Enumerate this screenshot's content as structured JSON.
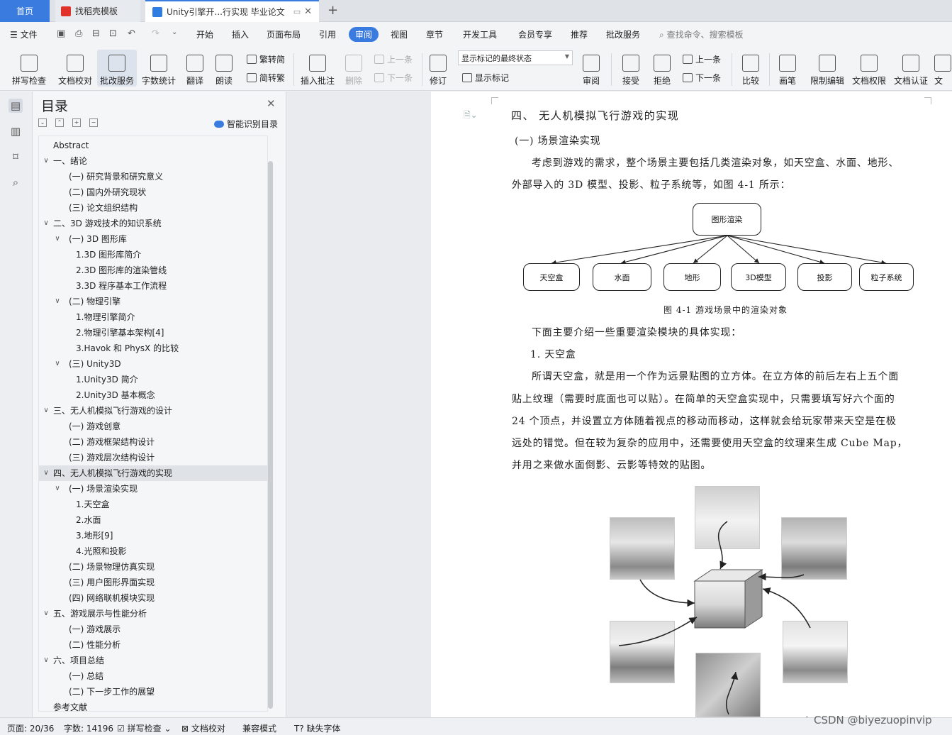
{
  "tabs": {
    "home": "首页",
    "template": "找稻壳模板",
    "document": "Unity引擎开...行实现 毕业论文",
    "plus": "+",
    "close": "✕"
  },
  "menu": {
    "file": "文件",
    "items": [
      "开始",
      "插入",
      "页面布局",
      "引用",
      "审阅",
      "视图",
      "章节",
      "开发工具",
      "会员专享",
      "推荐",
      "批改服务"
    ],
    "active": "审阅",
    "search": "查找命令、搜索模板"
  },
  "ribbon": {
    "spell": "拼写检查",
    "proof": "文档校对",
    "correct": "批改服务",
    "wordcount": "字数统计",
    "translate": "翻译",
    "read": "朗读",
    "trad": "繁转简",
    "simp": "简转繁",
    "insert_comment": "插入批注",
    "delete": "删除",
    "prev": "上一条",
    "next": "下一条",
    "track": "修订",
    "markup_state": "显示标记的最终状态",
    "show_markup": "显示标记",
    "review": "审阅",
    "accept": "接受",
    "reject": "拒绝",
    "prev2": "上一条",
    "next2": "下一条",
    "compare": "比较",
    "pen": "画笔",
    "restrict": "限制编辑",
    "perm": "文档权限",
    "cert": "文档认证",
    "more": "文"
  },
  "toc": {
    "title": "目录",
    "smart": "智能识别目录",
    "items": [
      {
        "text": "Abstract",
        "level": 0,
        "chev": ""
      },
      {
        "text": "一、绪论",
        "level": 0,
        "chev": "∨"
      },
      {
        "text": "(一) 研究背景和研究意义",
        "level": 1,
        "chev": ""
      },
      {
        "text": "(二) 国内外研究现状",
        "level": 1,
        "chev": ""
      },
      {
        "text": "(三) 论文组织结构",
        "level": 1,
        "chev": ""
      },
      {
        "text": "二、3D 游戏技术的知识系统",
        "level": 0,
        "chev": "∨"
      },
      {
        "text": "(一) 3D 图形库",
        "level": 1,
        "chev": "∨"
      },
      {
        "text": "1.3D 图形库简介",
        "level": 2,
        "chev": ""
      },
      {
        "text": "2.3D 图形库的渲染管线",
        "level": 2,
        "chev": ""
      },
      {
        "text": "3.3D 程序基本工作流程",
        "level": 2,
        "chev": ""
      },
      {
        "text": "(二) 物理引擎",
        "level": 1,
        "chev": "∨"
      },
      {
        "text": "1.物理引擎简介",
        "level": 2,
        "chev": ""
      },
      {
        "text": "2.物理引擎基本架构[4]",
        "level": 2,
        "chev": ""
      },
      {
        "text": "3.Havok 和 PhysX 的比较",
        "level": 2,
        "chev": ""
      },
      {
        "text": "(三) Unity3D",
        "level": 1,
        "chev": "∨"
      },
      {
        "text": "1.Unity3D 简介",
        "level": 2,
        "chev": ""
      },
      {
        "text": "2.Unity3D 基本概念",
        "level": 2,
        "chev": ""
      },
      {
        "text": "三、无人机模拟飞行游戏的设计",
        "level": 0,
        "chev": "∨"
      },
      {
        "text": "(一) 游戏创意",
        "level": 1,
        "chev": ""
      },
      {
        "text": "(二) 游戏框架结构设计",
        "level": 1,
        "chev": ""
      },
      {
        "text": "(三) 游戏层次结构设计",
        "level": 1,
        "chev": ""
      },
      {
        "text": "四、无人机模拟飞行游戏的实现",
        "level": 0,
        "chev": "∨",
        "selected": true
      },
      {
        "text": "(一) 场景渲染实现",
        "level": 1,
        "chev": "∨"
      },
      {
        "text": "1.天空盒",
        "level": 2,
        "chev": ""
      },
      {
        "text": "2.水面",
        "level": 2,
        "chev": ""
      },
      {
        "text": "3.地形[9]",
        "level": 2,
        "chev": ""
      },
      {
        "text": "4.光照和投影",
        "level": 2,
        "chev": ""
      },
      {
        "text": "(二) 场景物理仿真实现",
        "level": 1,
        "chev": ""
      },
      {
        "text": "(三) 用户图形界面实现",
        "level": 1,
        "chev": ""
      },
      {
        "text": "(四) 网络联机模块实现",
        "level": 1,
        "chev": ""
      },
      {
        "text": "五、游戏展示与性能分析",
        "level": 0,
        "chev": "∨"
      },
      {
        "text": "(一) 游戏展示",
        "level": 1,
        "chev": ""
      },
      {
        "text": "(二) 性能分析",
        "level": 1,
        "chev": ""
      },
      {
        "text": "六、项目总结",
        "level": 0,
        "chev": "∨"
      },
      {
        "text": "(一) 总结",
        "level": 1,
        "chev": ""
      },
      {
        "text": "(二) 下一步工作的展望",
        "level": 1,
        "chev": ""
      },
      {
        "text": "参考文献",
        "level": 0,
        "chev": ""
      }
    ]
  },
  "document": {
    "heading": "四、   无人机模拟飞行游戏的实现",
    "subheading": "(一)   场景渲染实现",
    "para1_line1": "考虑到游戏的需求，整个场景主要包括几类渲染对象，如天空盒、水面、地形、",
    "para1_line2": "外部导入的 3D 模型、投影、粒子系统等，如图 4-1 所示：",
    "diagram_root": "图形渲染",
    "diagram_children": [
      "天空盒",
      "水面",
      "地形",
      "3D模型",
      "投影",
      "粒子系统"
    ],
    "caption": "图 4-1  游戏场景中的渲染对象",
    "para2": "下面主要介绍一些重要渲染模块的具体实现：",
    "item1": "1.   天空盒",
    "para3_l1": "所谓天空盒，就是用一个作为远景贴图的立方体。在立方体的前后左右上五个面",
    "para3_l2": "贴上纹理（需要时底面也可以贴）。在简单的天空盒实现中，只需要填写好六个面的",
    "para3_l3": "24 个顶点，并设置立方体随着视点的移动而移动，这样就会给玩家带来天空是在极",
    "para3_l4": "远处的错觉。但在较为复杂的应用中，还需要使用天空盒的纹理来生成 Cube Map，",
    "para3_l5": "并用之来做水面倒影、云影等特效的贴图。"
  },
  "status": {
    "page": "页面: 20/36",
    "words": "字数: 14196",
    "spell": "拼写检查",
    "proof": "文档校对",
    "compat": "兼容模式",
    "missing_font": "缺失字体"
  },
  "watermark": "CSDN @biyezuopinvip",
  "colors": {
    "accent": "#3a7be0",
    "tab_red": "#e0322b"
  }
}
